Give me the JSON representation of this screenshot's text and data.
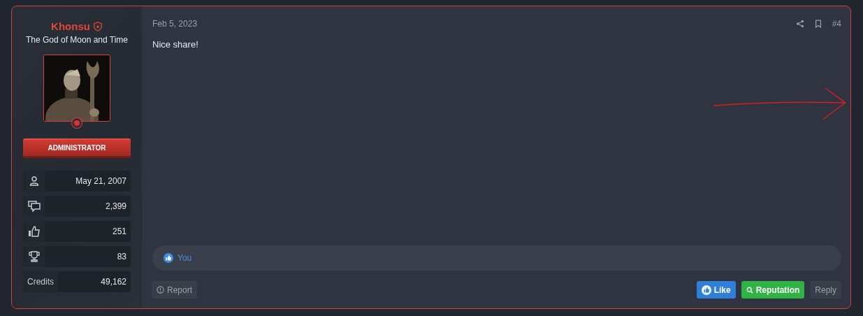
{
  "user": {
    "name": "Khonsu",
    "title": "The God of Moon and Time",
    "online": true,
    "banner": "ADMINISTRATOR",
    "stats": [
      {
        "kind": "joined",
        "value": "May 21, 2007"
      },
      {
        "kind": "messages",
        "value": "2,399"
      },
      {
        "kind": "reactions",
        "value": "251"
      },
      {
        "kind": "points",
        "value": "83"
      },
      {
        "kind": "label",
        "label": "Credits",
        "value": "49,162"
      }
    ]
  },
  "post": {
    "date": "Feb 5, 2023",
    "number": "#4",
    "body": "Nice share!",
    "reactions": {
      "by": "You"
    },
    "actions": {
      "report": "Report",
      "like": "Like",
      "reputation": "Reputation",
      "reply": "Reply"
    }
  }
}
